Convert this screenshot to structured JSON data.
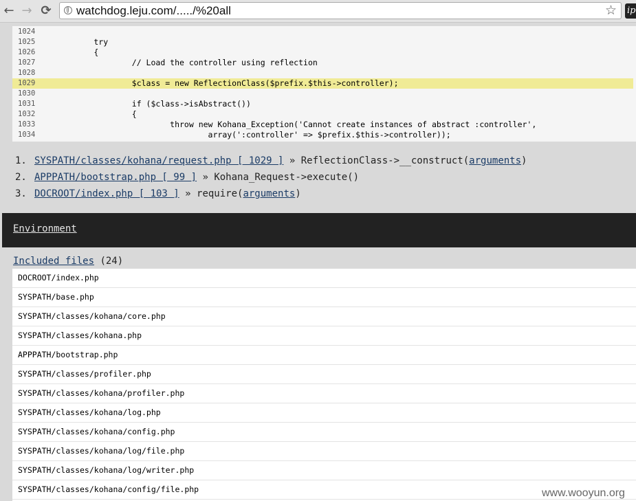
{
  "browser": {
    "back_glyph": "←",
    "forward_glyph": "→",
    "reload_glyph": "⟳",
    "url": "watchdog.leju.com/...../%20all",
    "star_glyph": "☆",
    "extension_label": "ip"
  },
  "code": {
    "lines": [
      {
        "n": "1024",
        "text": ""
      },
      {
        "n": "1025",
        "text": "        try"
      },
      {
        "n": "1026",
        "text": "        {"
      },
      {
        "n": "1027",
        "text": "                // Load the controller using reflection"
      },
      {
        "n": "1028",
        "text": ""
      },
      {
        "n": "1029",
        "text": "                $class = new ReflectionClass($prefix.$this->controller);"
      },
      {
        "n": "1030",
        "text": ""
      },
      {
        "n": "1031",
        "text": "                if ($class->isAbstract())"
      },
      {
        "n": "1032",
        "text": "                {"
      },
      {
        "n": "1033",
        "text": "                        throw new Kohana_Exception('Cannot create instances of abstract :controller',"
      },
      {
        "n": "1034",
        "text": "                                array(':controller' => $prefix.$this->controller));"
      }
    ],
    "highlight_color": "#f0eb96"
  },
  "trace": [
    {
      "num": "1.",
      "file": "SYSPATH/classes/kohana/request.php [ 1029 ]",
      "sep": " » ",
      "call": "ReflectionClass->__construct(",
      "args": "arguments",
      "close": ")"
    },
    {
      "num": "2.",
      "file": "APPPATH/bootstrap.php [ 99 ]",
      "sep": " » ",
      "call": "Kohana_Request->execute()",
      "args": "",
      "close": ""
    },
    {
      "num": "3.",
      "file": "DOCROOT/index.php [ 103 ]",
      "sep": " » ",
      "call": "require(",
      "args": "arguments",
      "close": ")"
    }
  ],
  "environment": {
    "label": "Environment"
  },
  "included": {
    "label": "Included files",
    "count": " (24)",
    "files": [
      "DOCROOT/index.php",
      "SYSPATH/base.php",
      "SYSPATH/classes/kohana/core.php",
      "SYSPATH/classes/kohana.php",
      "APPPATH/bootstrap.php",
      "SYSPATH/classes/profiler.php",
      "SYSPATH/classes/kohana/profiler.php",
      "SYSPATH/classes/kohana/log.php",
      "SYSPATH/classes/kohana/config.php",
      "SYSPATH/classes/kohana/log/file.php",
      "SYSPATH/classes/kohana/log/writer.php",
      "SYSPATH/classes/kohana/config/file.php"
    ]
  },
  "watermark": "www.wooyun.org"
}
